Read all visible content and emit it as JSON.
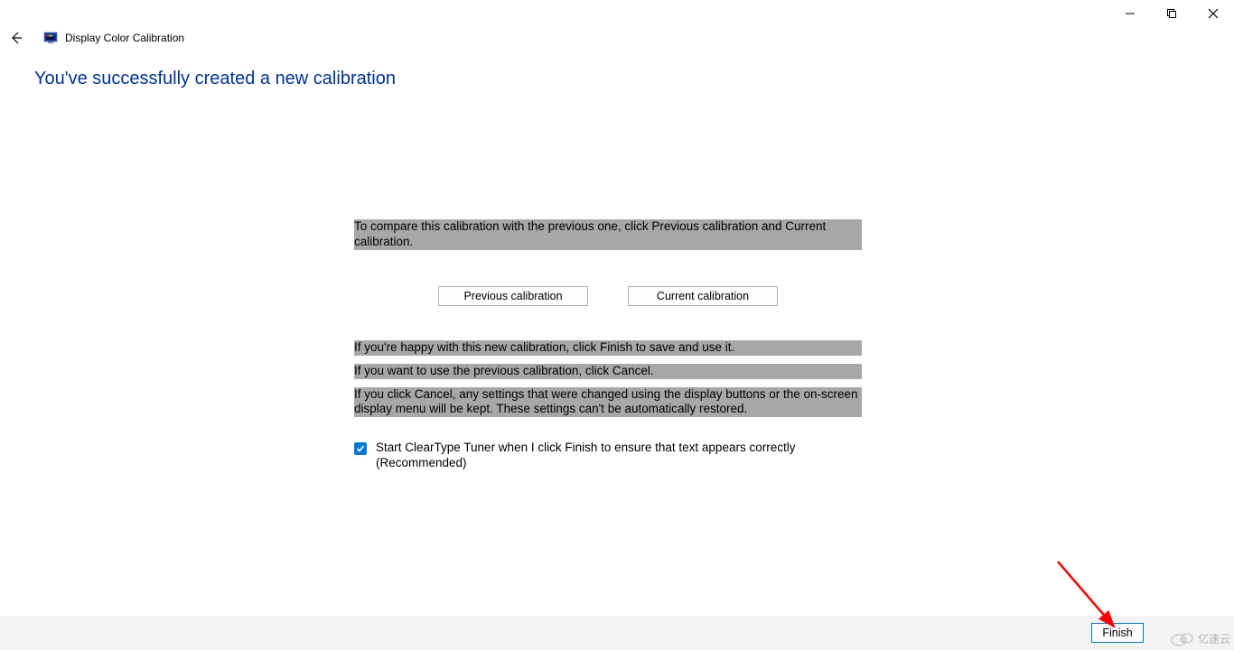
{
  "window": {
    "title": "Display Color Calibration"
  },
  "heading": "You've successfully created a new calibration",
  "body": {
    "para_compare": "To compare this calibration with the previous one, click Previous calibration and Current calibration.",
    "btn_previous": "Previous calibration",
    "btn_current": "Current calibration",
    "para_finish": "If you're happy with this new calibration, click Finish to save and use it.",
    "para_cancel": "If you want to use the previous calibration, click Cancel.",
    "para_warn": "If you click Cancel, any settings that were changed using the display buttons or the on-screen display menu will be kept. These settings can't be automatically restored.",
    "checkbox": {
      "checked": true,
      "label": "Start ClearType Tuner when I click Finish to ensure that text appears correctly (Recommended)"
    }
  },
  "footer": {
    "finish": "Finish"
  },
  "watermark": "亿速云"
}
